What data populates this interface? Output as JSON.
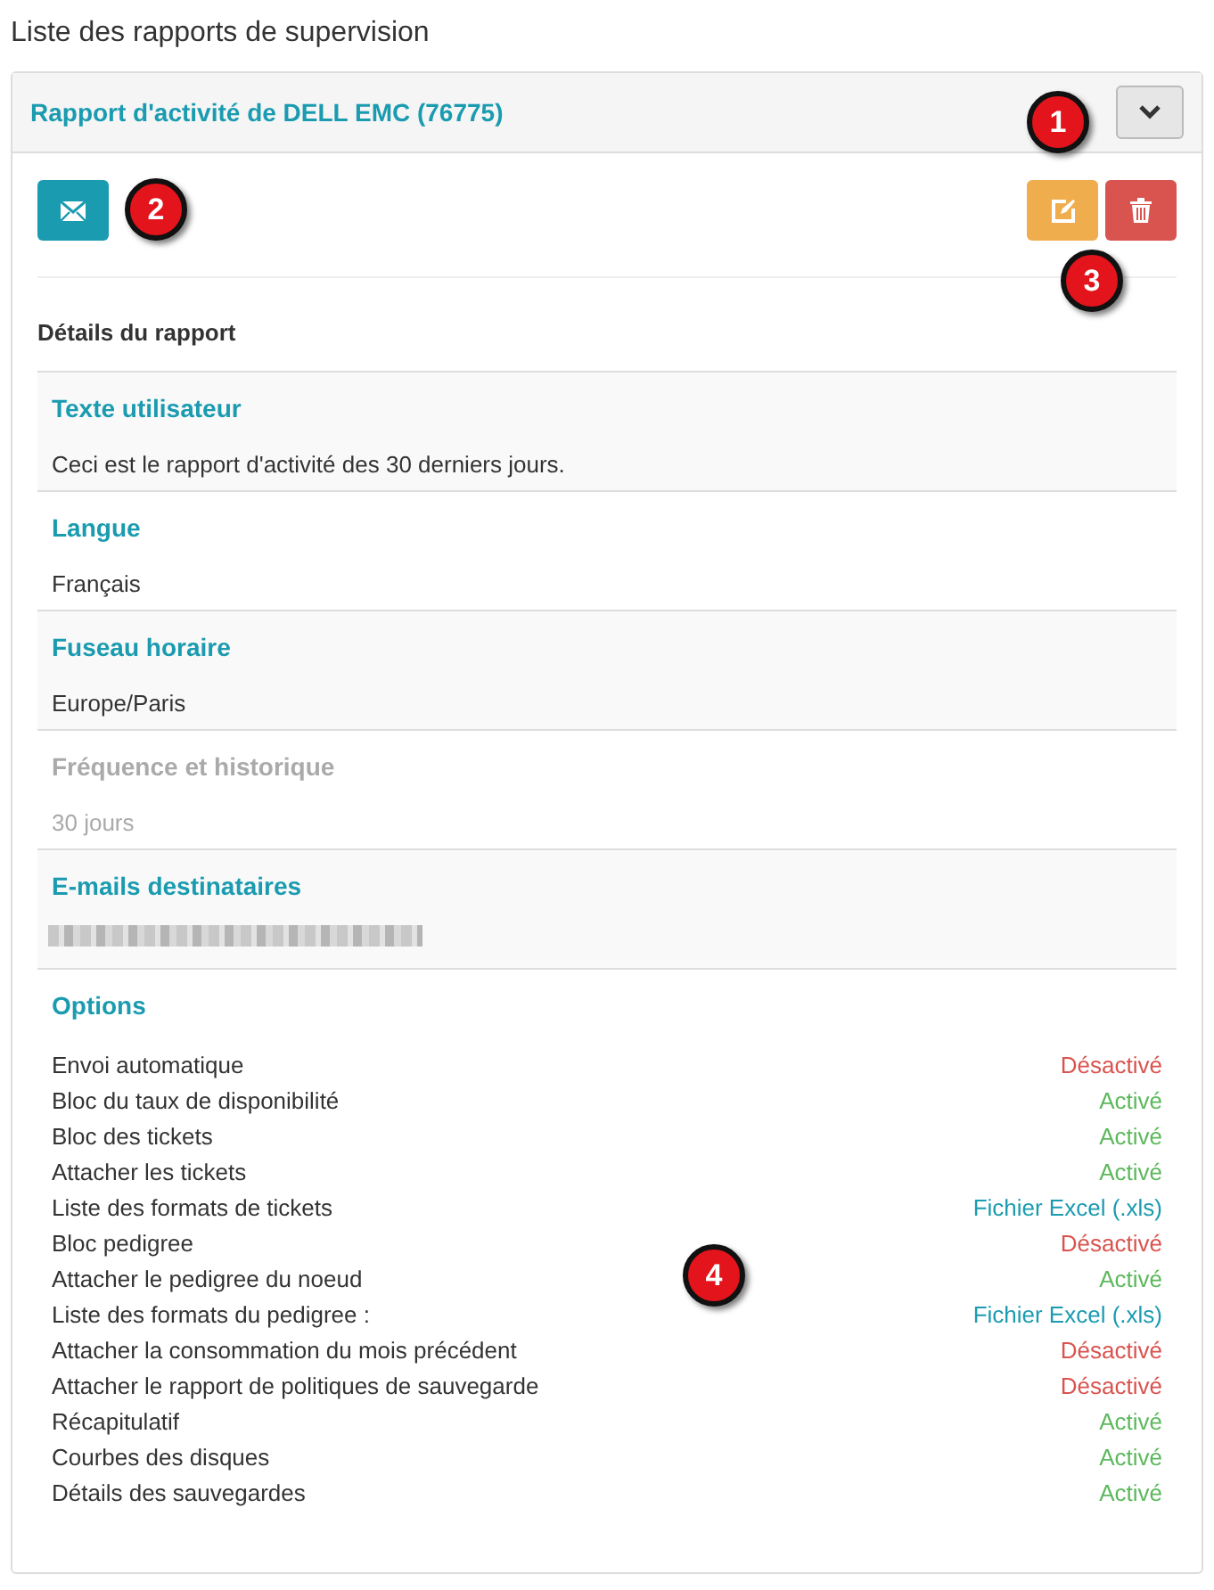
{
  "page_title": "Liste des rapports de supervision",
  "report": {
    "title": "Rapport d'activité de DELL EMC (76775)",
    "expanded": true,
    "section_title": "Détails du rapport",
    "fields": [
      {
        "label": "Texte utilisateur",
        "value": "Ceci est le rapport d'activité des 30 derniers jours.",
        "disabled": false
      },
      {
        "label": "Langue",
        "value": "Français",
        "disabled": false
      },
      {
        "label": "Fuseau horaire",
        "value": "Europe/Paris",
        "disabled": false
      },
      {
        "label": "Fréquence et historique",
        "value": "30 jours",
        "disabled": true
      },
      {
        "label": "E-mails destinataires",
        "redacted": true,
        "disabled": false
      }
    ],
    "options_title": "Options",
    "options": [
      {
        "label": "Envoi automatique",
        "value": "Désactivé",
        "kind": "off"
      },
      {
        "label": "Bloc du taux de disponibilité",
        "value": "Activé",
        "kind": "on"
      },
      {
        "label": "Bloc des tickets",
        "value": "Activé",
        "kind": "on"
      },
      {
        "label": "Attacher les tickets",
        "value": "Activé",
        "kind": "on"
      },
      {
        "label": "Liste des formats de tickets",
        "value": "Fichier Excel (.xls)",
        "kind": "format"
      },
      {
        "label": "Bloc pedigree",
        "value": "Désactivé",
        "kind": "off"
      },
      {
        "label": "Attacher le pedigree du noeud",
        "value": "Activé",
        "kind": "on"
      },
      {
        "label": "Liste des formats du pedigree :",
        "value": "Fichier Excel (.xls)",
        "kind": "format"
      },
      {
        "label": "Attacher la consommation du mois précédent",
        "value": "Désactivé",
        "kind": "off"
      },
      {
        "label": "Attacher le rapport de politiques de sauvegarde",
        "value": "Désactivé",
        "kind": "off"
      },
      {
        "label": "Récapitulatif",
        "value": "Activé",
        "kind": "on"
      },
      {
        "label": "Courbes des disques",
        "value": "Activé",
        "kind": "on"
      },
      {
        "label": "Détails des sauvegardes",
        "value": "Activé",
        "kind": "on"
      }
    ]
  },
  "callouts": [
    "1",
    "2",
    "3",
    "4"
  ]
}
